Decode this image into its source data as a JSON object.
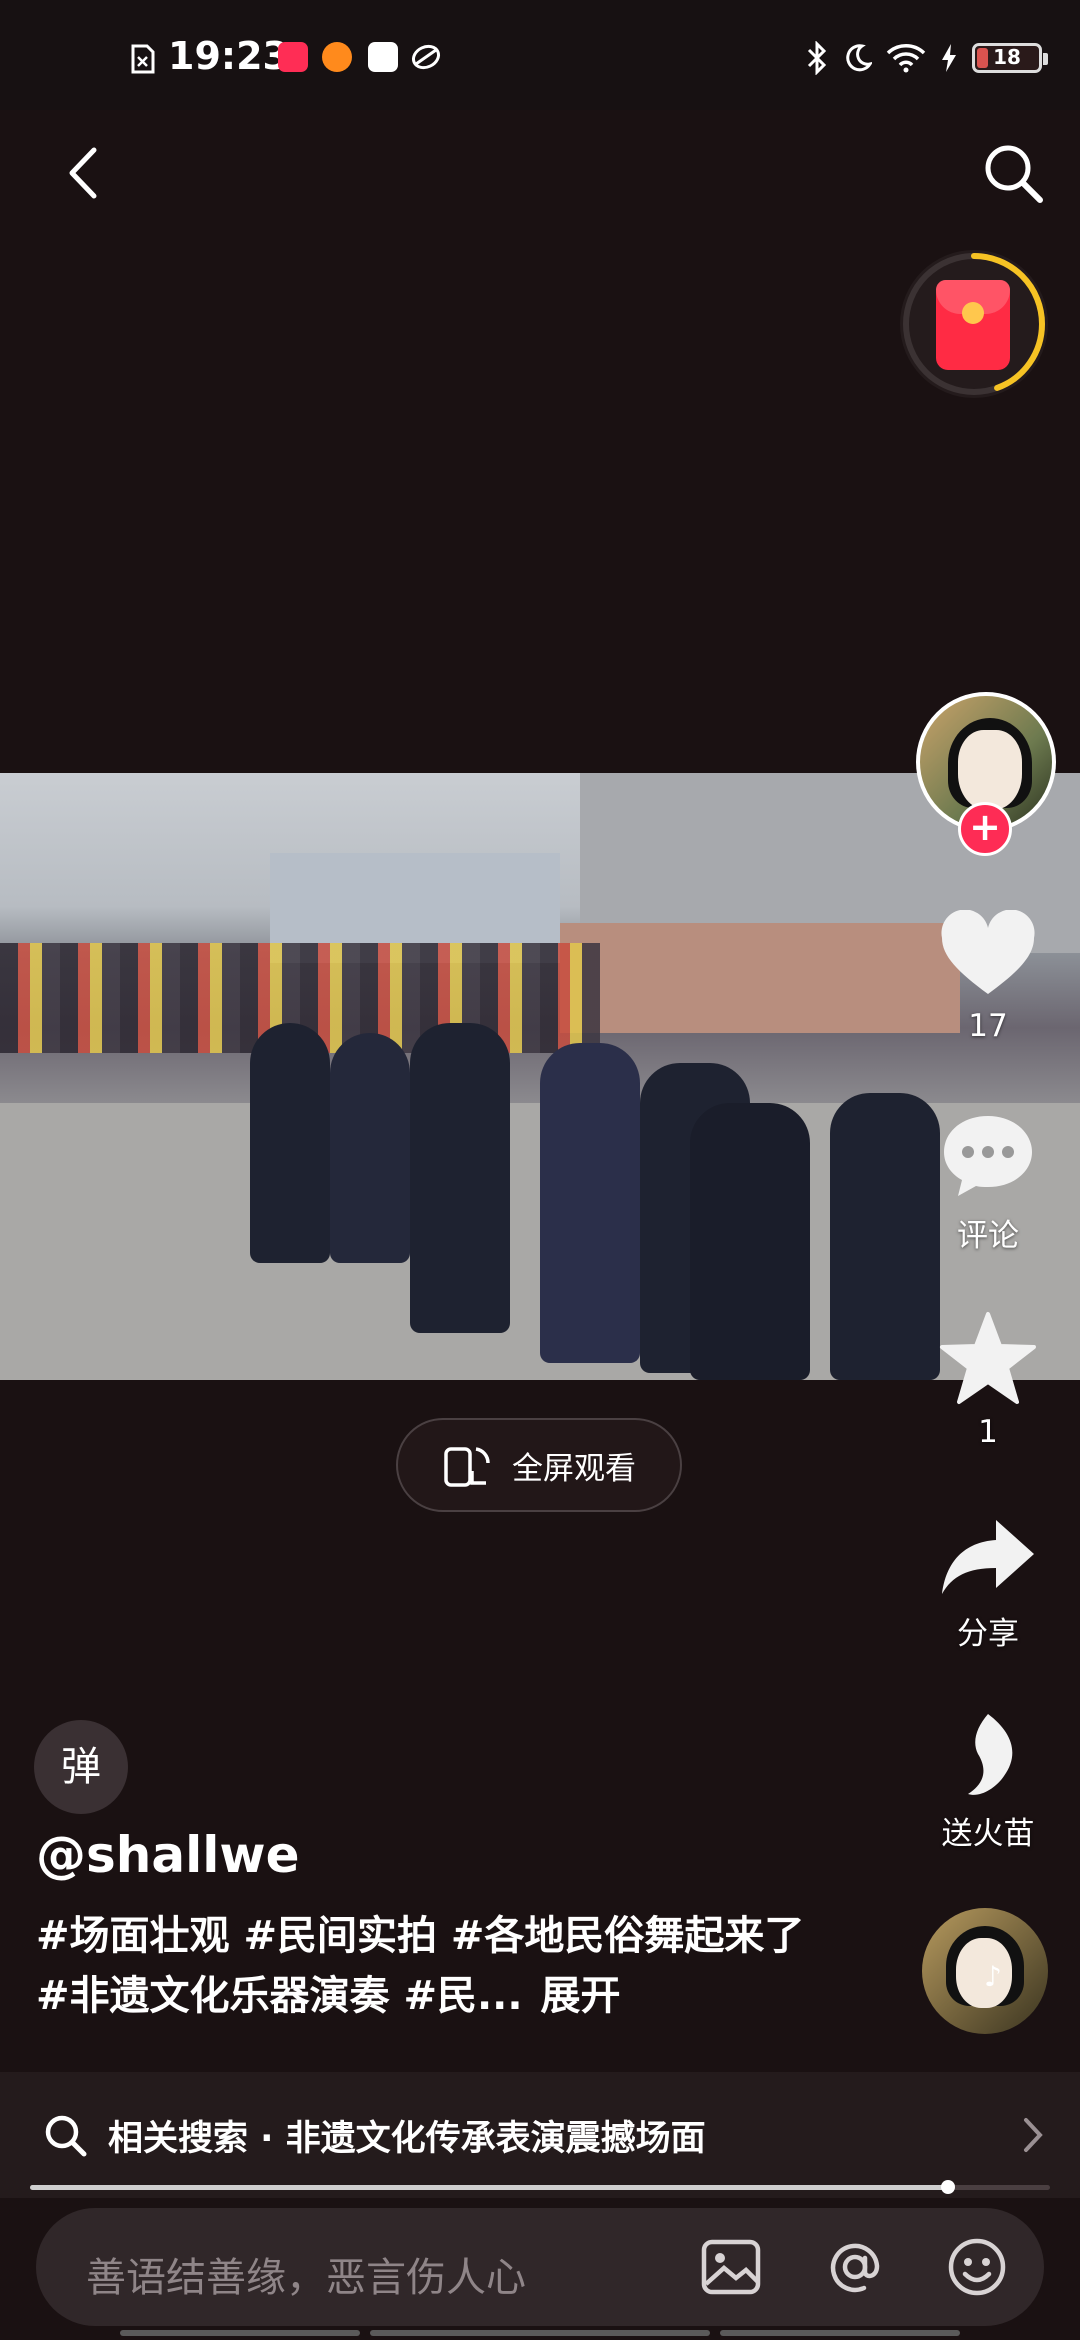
{
  "status_bar": {
    "time": "19:23",
    "battery_level": "18",
    "battery_fraction": 0.18,
    "app_icons": [
      "sim-off-icon",
      "app-red-icon",
      "app-orange-icon",
      "mail-icon",
      "app-swirl-icon"
    ],
    "right_icons": [
      "bluetooth-icon",
      "moon-icon",
      "wifi-icon",
      "charging-icon"
    ]
  },
  "colors": {
    "accent": "#fe2c55",
    "gold_ring": "#f6c324",
    "background": "#1a1112"
  },
  "video": {
    "fullscreen_label": "全屏观看"
  },
  "rail": {
    "like_count": "17",
    "comment_label": "评论",
    "favorite_count": "1",
    "share_label": "分享",
    "gift_label": "送火苗"
  },
  "danmu_toggle": "弹",
  "post": {
    "author": "@shallwe",
    "caption": "#场面壮观 #民间实拍 #各地民俗舞起来了 #非遗文化乐器演奏 #民...",
    "expand_label": "展开"
  },
  "related_search": {
    "text": "相关搜索 · 非遗文化传承表演震撼场面"
  },
  "playback": {
    "progress": 0.9
  },
  "comment_input": {
    "placeholder": "善语结善缘，恶言伤人心"
  }
}
